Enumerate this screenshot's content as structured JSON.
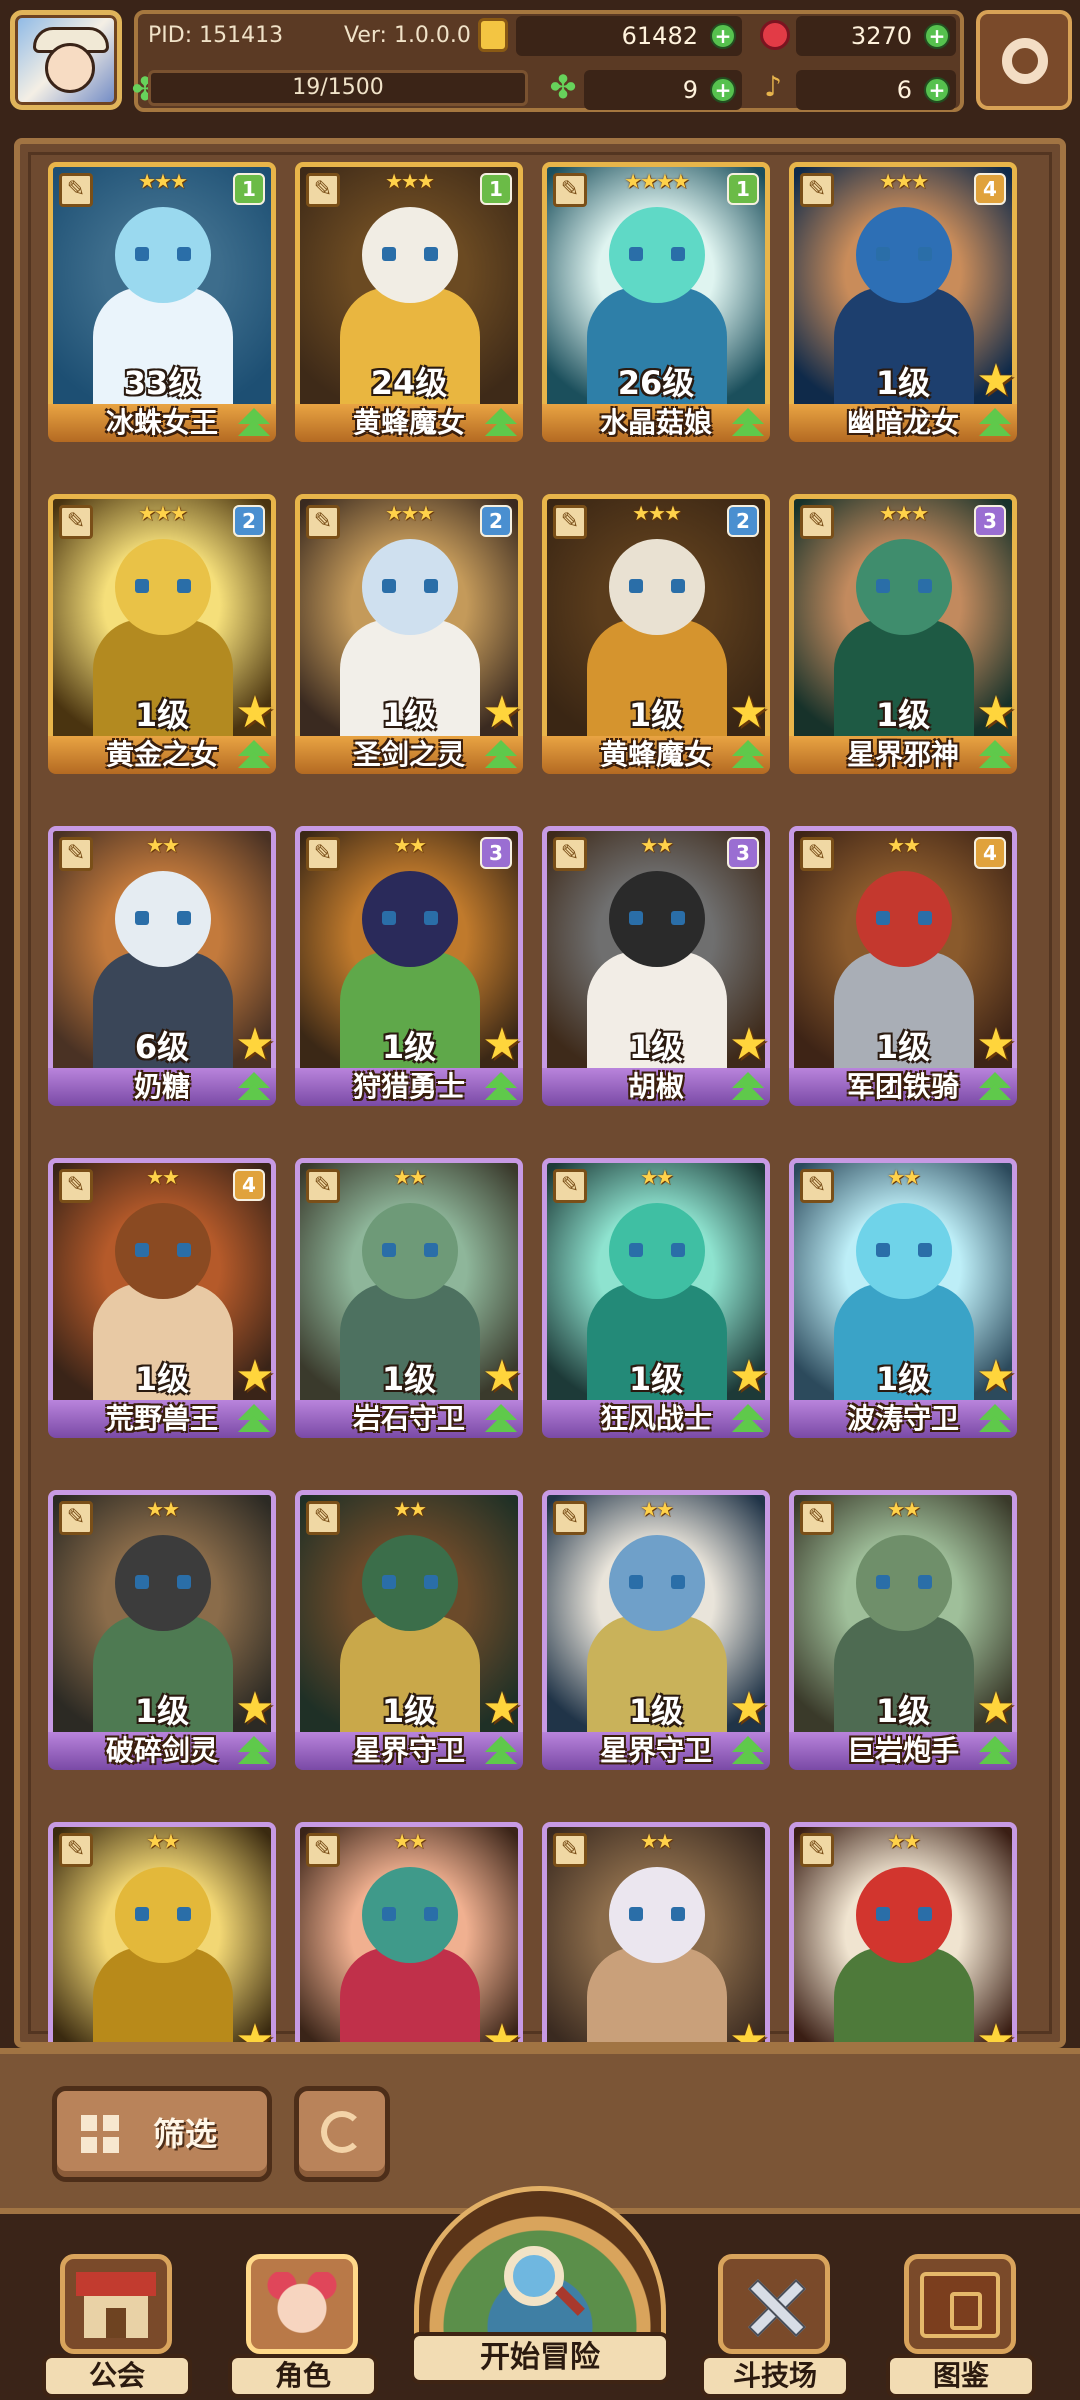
{
  "hud": {
    "pid": "PID: 151413",
    "version": "Ver: 1.0.0.0",
    "gold": "61482",
    "gems": "3270",
    "stamina": "19/1500",
    "clover": "9",
    "keys": "6"
  },
  "cards": [
    {
      "stars": "★★★",
      "badge": "1",
      "badge_tier": "b1",
      "level": "33级",
      "name": "冰蛛女王",
      "tier": "gold",
      "palette": [
        "#1d4f73",
        "#9ad9ef",
        "#eaf4fb",
        "#3d6d8c"
      ],
      "star_button": false
    },
    {
      "stars": "★★★",
      "badge": "1",
      "badge_tier": "b1",
      "level": "24级",
      "name": "黄蜂魔女",
      "tier": "gold",
      "palette": [
        "#3e2a18",
        "#f1ede4",
        "#e9b640",
        "#6b4a22"
      ],
      "star_button": false
    },
    {
      "stars": "★★★★",
      "badge": "1",
      "badge_tier": "b1",
      "level": "26级",
      "name": "水晶菇娘",
      "tier": "gold",
      "palette": [
        "#1b4f5c",
        "#5fd9c6",
        "#2e7fa8",
        "#dff4f0"
      ],
      "star_button": false
    },
    {
      "stars": "★★★",
      "badge": "4",
      "badge_tier": "b4",
      "level": "1级",
      "name": "幽暗龙女",
      "tier": "gold",
      "palette": [
        "#0f2a4a",
        "#2d6fb5",
        "#1d3f6e",
        "#c98c5a"
      ],
      "star_button": true
    },
    {
      "stars": "★★★",
      "badge": "2",
      "badge_tier": "b2",
      "level": "1级",
      "name": "黄金之女",
      "tier": "gold",
      "palette": [
        "#4a3410",
        "#e9c247",
        "#b38a20",
        "#f5df7a"
      ],
      "star_button": true
    },
    {
      "stars": "★★★",
      "badge": "2",
      "badge_tier": "b2",
      "level": "1级",
      "name": "圣剑之灵",
      "tier": "gold",
      "palette": [
        "#3a2a20",
        "#cfe0ef",
        "#f2efe9",
        "#c49a5a"
      ],
      "star_button": true
    },
    {
      "stars": "★★★",
      "badge": "2",
      "badge_tier": "b2",
      "level": "1级",
      "name": "黄蜂魔女",
      "tier": "gold",
      "palette": [
        "#3a2614",
        "#e9e1d2",
        "#d5942e",
        "#5a3c1c"
      ],
      "star_button": true
    },
    {
      "stars": "★★★",
      "badge": "3",
      "badge_tier": "b3",
      "level": "1级",
      "name": "星界邪神",
      "tier": "gold",
      "palette": [
        "#17322a",
        "#3f8d6d",
        "#1e5a44",
        "#c28a5e"
      ],
      "star_button": true
    },
    {
      "stars": "★★",
      "badge": "",
      "badge_tier": "",
      "level": "6级",
      "name": "奶糖",
      "tier": "purple",
      "palette": [
        "#4a3224",
        "#e5ecf2",
        "#3a4658",
        "#c37a3c"
      ],
      "star_button": true
    },
    {
      "stars": "★★",
      "badge": "3",
      "badge_tier": "b3",
      "level": "1级",
      "name": "狩猎勇士",
      "tier": "purple",
      "palette": [
        "#3b2816",
        "#2a2a5a",
        "#5fa84a",
        "#c07a2c"
      ],
      "star_button": true
    },
    {
      "stars": "★★",
      "badge": "3",
      "badge_tier": "b3",
      "level": "1级",
      "name": "胡椒",
      "tier": "purple",
      "palette": [
        "#3e2a1a",
        "#2a2a2a",
        "#f2ede6",
        "#6f6f6f"
      ],
      "star_button": true
    },
    {
      "stars": "★★",
      "badge": "4",
      "badge_tier": "b4",
      "level": "1级",
      "name": "军团铁骑",
      "tier": "purple",
      "palette": [
        "#3e2416",
        "#c4382e",
        "#a9aeb6",
        "#8a5a2c"
      ],
      "star_button": true
    },
    {
      "stars": "★★",
      "badge": "4",
      "badge_tier": "b4",
      "level": "1级",
      "name": "荒野兽王",
      "tier": "purple",
      "palette": [
        "#3a2418",
        "#8a4a22",
        "#e8c9a4",
        "#b55a2a"
      ],
      "star_button": true
    },
    {
      "stars": "★★",
      "badge": "",
      "badge_tier": "",
      "level": "1级",
      "name": "岩石守卫",
      "tier": "purple",
      "palette": [
        "#3a3a2c",
        "#6e9a78",
        "#4d7160",
        "#8eb69a"
      ],
      "star_button": true
    },
    {
      "stars": "★★",
      "badge": "",
      "badge_tier": "",
      "level": "1级",
      "name": "狂风战士",
      "tier": "purple",
      "palette": [
        "#1d3a38",
        "#3fbfa3",
        "#238a78",
        "#8ee3cf"
      ],
      "star_button": true
    },
    {
      "stars": "★★",
      "badge": "",
      "badge_tier": "",
      "level": "1级",
      "name": "波涛守卫",
      "tier": "purple",
      "palette": [
        "#2c4a5c",
        "#6fd3e9",
        "#3aa3c7",
        "#bdeef7"
      ],
      "star_button": true
    },
    {
      "stars": "★★",
      "badge": "",
      "badge_tier": "",
      "level": "1级",
      "name": "破碎剑灵",
      "tier": "purple",
      "palette": [
        "#2c2a24",
        "#3c3c3c",
        "#4e7a52",
        "#8a6c4a"
      ],
      "star_button": true
    },
    {
      "stars": "★★",
      "badge": "",
      "badge_tier": "",
      "level": "1级",
      "name": "星界守卫",
      "tier": "purple",
      "palette": [
        "#1f3026",
        "#3b6e4a",
        "#c9a84a",
        "#6b4a2a"
      ],
      "star_button": true
    },
    {
      "stars": "★★",
      "badge": "",
      "badge_tier": "",
      "level": "1级",
      "name": "星界守卫",
      "tier": "purple",
      "palette": [
        "#203448",
        "#6fa0c9",
        "#c9b25a",
        "#e9e4da"
      ],
      "star_button": true
    },
    {
      "stars": "★★",
      "badge": "",
      "badge_tier": "",
      "level": "1级",
      "name": "巨岩炮手",
      "tier": "purple",
      "palette": [
        "#3a3a2a",
        "#6f8f6a",
        "#4e6b52",
        "#9fbf9a"
      ],
      "star_button": true
    },
    {
      "stars": "★★",
      "badge": "",
      "badge_tier": "",
      "level": "",
      "name": "",
      "tier": "purple",
      "palette": [
        "#3a2a10",
        "#e3b83a",
        "#b88a1a",
        "#f2d774"
      ],
      "star_button": true
    },
    {
      "stars": "★★",
      "badge": "",
      "badge_tier": "",
      "level": "",
      "name": "",
      "tier": "purple",
      "palette": [
        "#3a2418",
        "#3f9a8a",
        "#c0304a",
        "#f0b090"
      ],
      "star_button": true
    },
    {
      "stars": "★★",
      "badge": "",
      "badge_tier": "",
      "level": "",
      "name": "",
      "tier": "purple",
      "palette": [
        "#3a2a20",
        "#ebe6ef",
        "#c9a07a",
        "#8a6b4a"
      ],
      "star_button": true
    },
    {
      "stars": "★★",
      "badge": "",
      "badge_tier": "",
      "level": "",
      "name": "",
      "tier": "purple",
      "palette": [
        "#3a1e14",
        "#d2352e",
        "#4e7a3a",
        "#f0e4d0"
      ],
      "star_button": true
    }
  ],
  "filter": {
    "label": "筛选"
  },
  "nav": {
    "guild": "公会",
    "character": "角色",
    "adventure": "开始冒险",
    "arena": "斗技场",
    "codex": "图鉴"
  }
}
